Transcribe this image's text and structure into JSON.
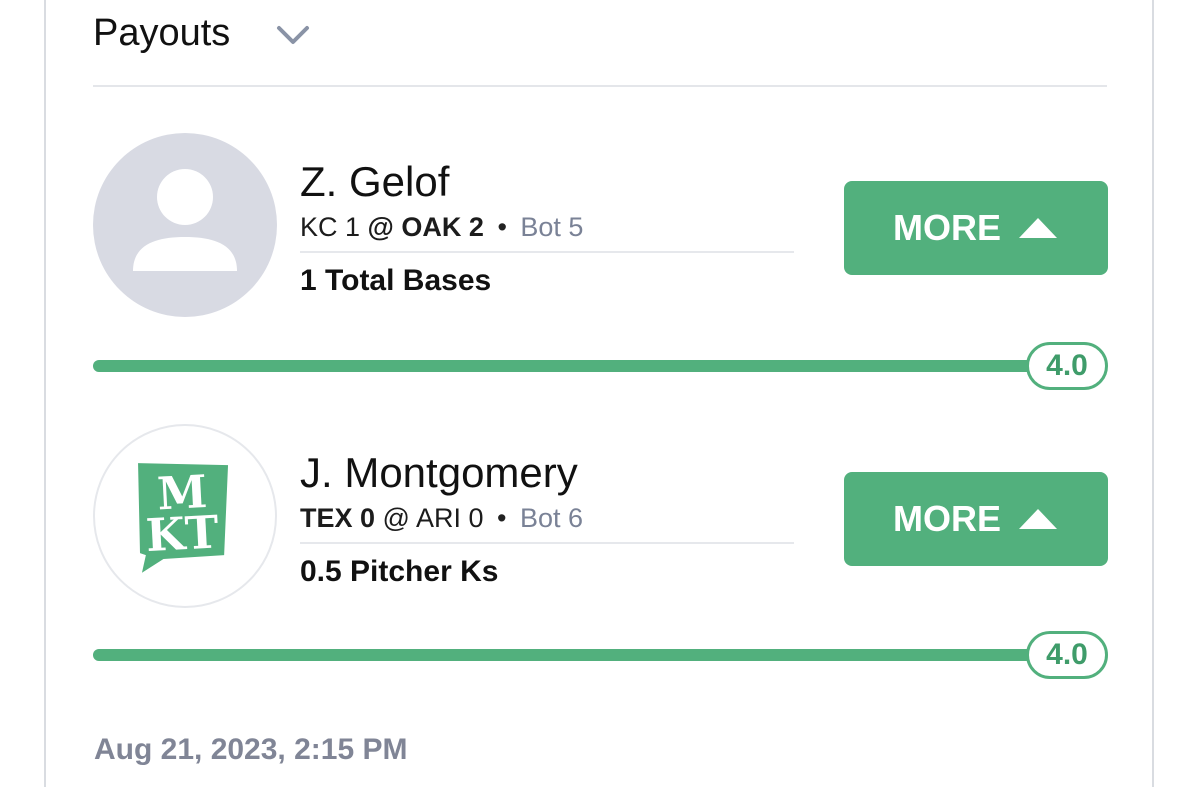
{
  "header": {
    "title": "Payouts",
    "toggle_icon": "chevron-down-icon"
  },
  "picks": [
    {
      "avatar_icon": "user-placeholder-icon",
      "player": "Z. Gelof",
      "game": {
        "away_team": "KC 1",
        "separator": "@",
        "home_team": "OAK 2",
        "bullet": "•",
        "inning": "Bot 5"
      },
      "stat": "1 Total Bases",
      "more_label": "MORE",
      "more_icon": "triangle-up-icon",
      "progress": {
        "fraction": 1.0,
        "value": "4.0"
      }
    },
    {
      "avatar_icon": "mkt-logo",
      "avatar_logo_text": "MKT",
      "player": "J. Montgomery",
      "game": {
        "away_team": "TEX 0",
        "separator": "@",
        "home_team": "ARI 0",
        "bullet": "•",
        "inning": "Bot 6"
      },
      "stat": "0.5 Pitcher Ks",
      "more_label": "MORE",
      "more_icon": "triangle-up-icon",
      "progress": {
        "fraction": 1.0,
        "value": "4.0"
      }
    }
  ],
  "footer": {
    "timestamp": "Aug 21, 2023, 2:15 PM"
  },
  "colors": {
    "accent": "#52b07d",
    "avatar_gray": "#d8dae3",
    "muted_text": "#7a8296"
  }
}
